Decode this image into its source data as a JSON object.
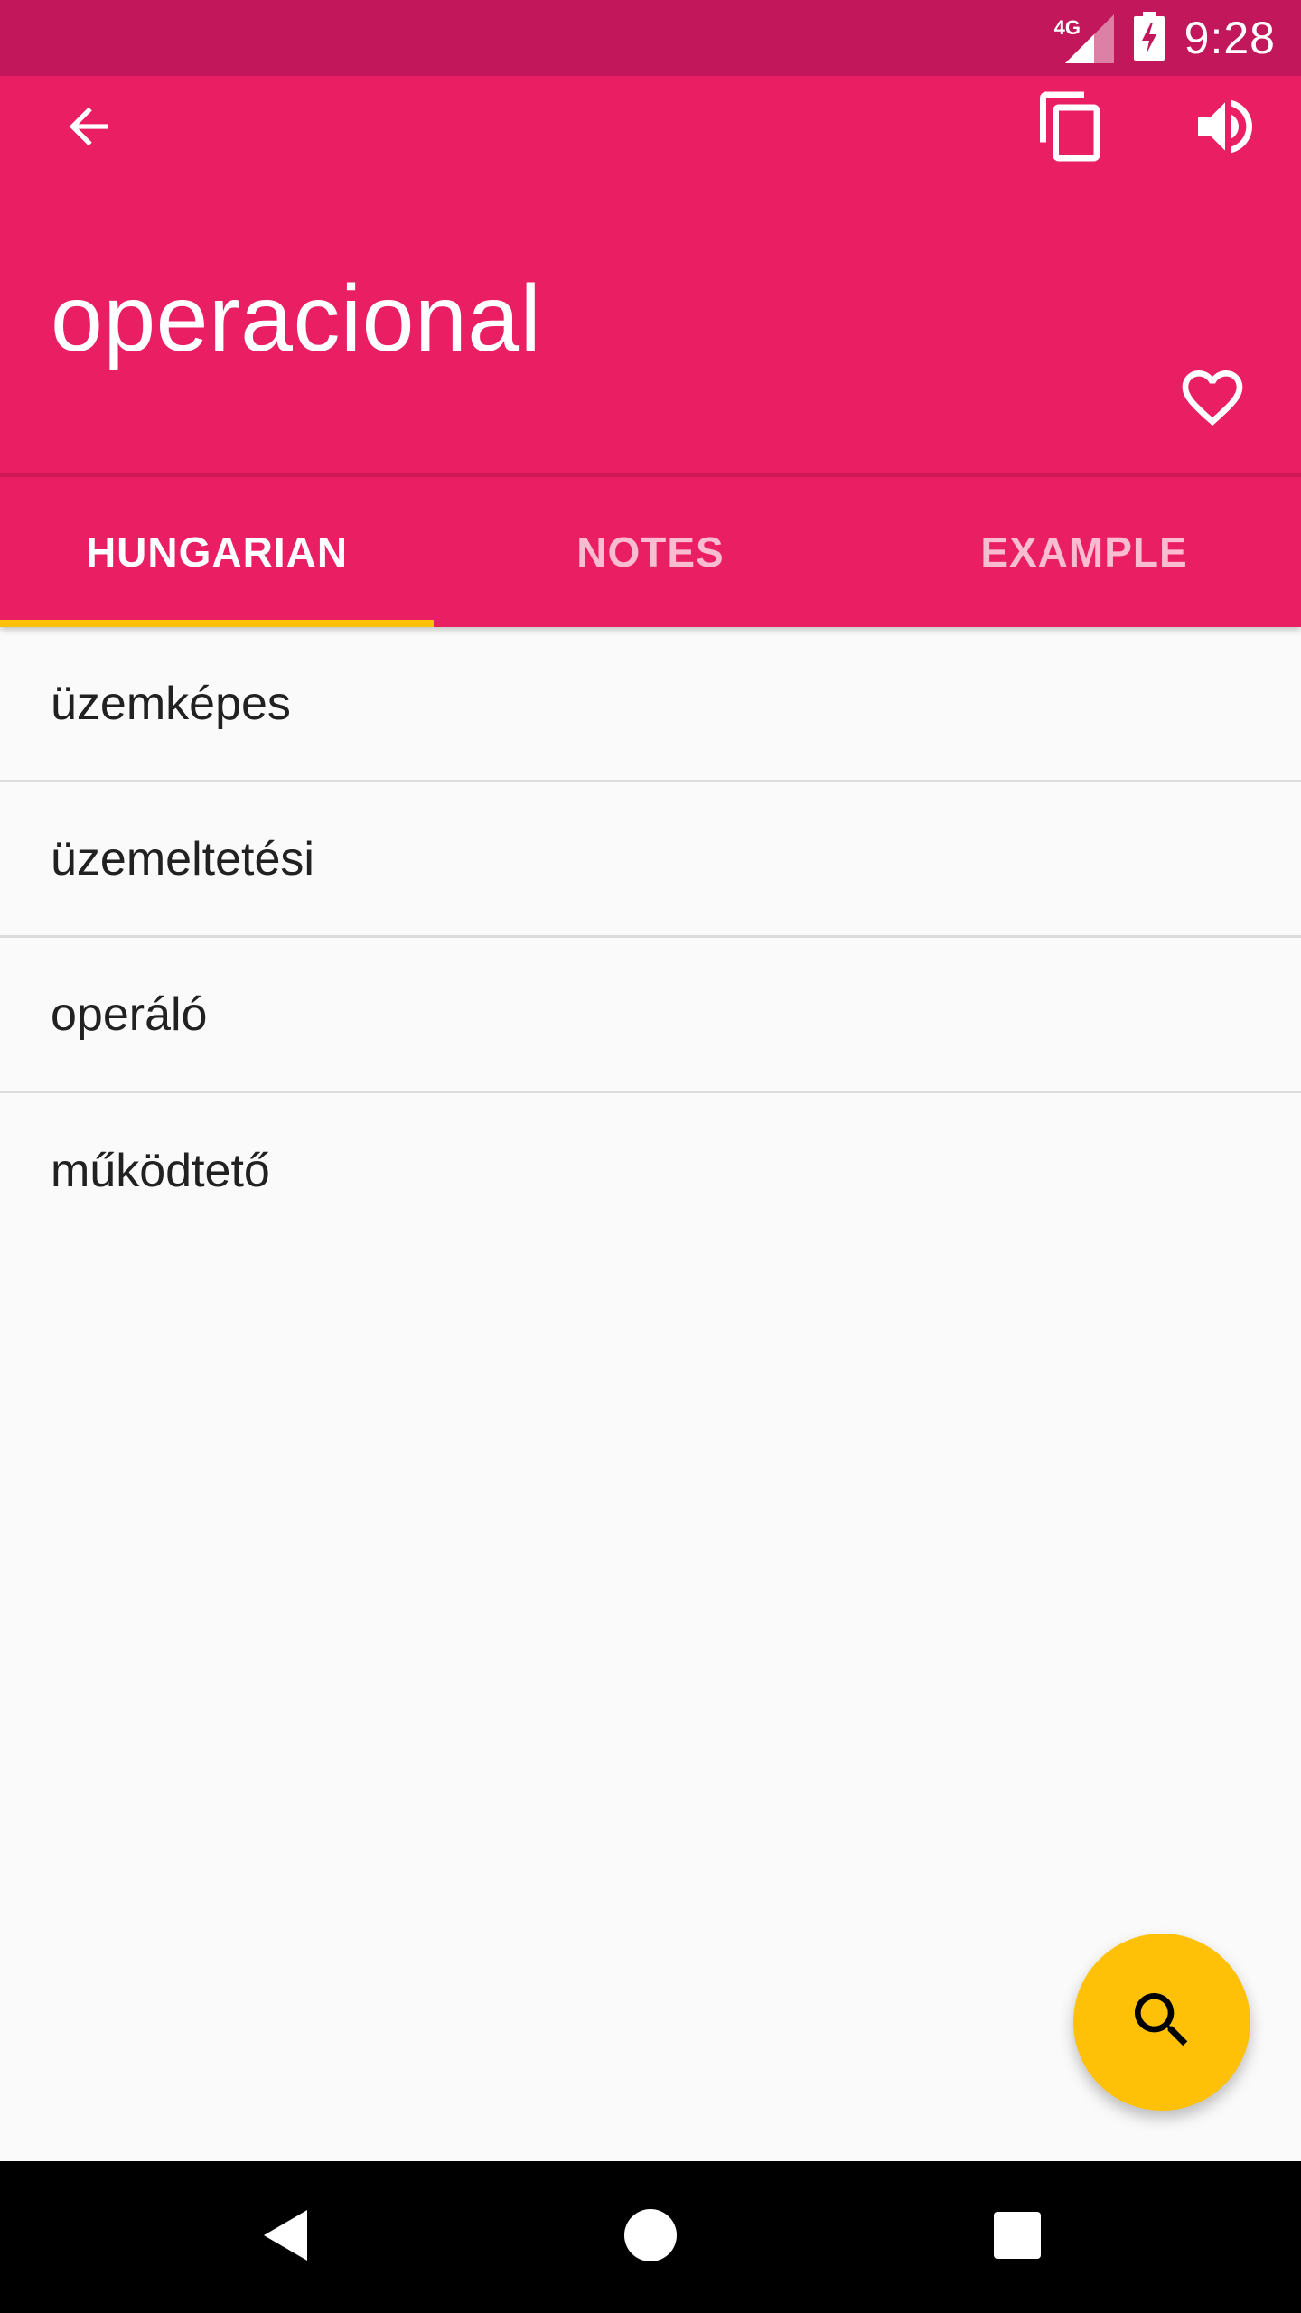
{
  "status_bar": {
    "network_label": "4G",
    "time": "9:28",
    "background_color": "#c2185b"
  },
  "app_bar": {
    "background_color": "#e91e63",
    "back_icon": "arrow-back-icon",
    "copy_icon": "copy-icon",
    "sound_icon": "volume-up-icon",
    "favorite_icon": "heart-outline-icon",
    "title": "operacional"
  },
  "tabs": [
    {
      "label": "HUNGARIAN",
      "active": true
    },
    {
      "label": "NOTES",
      "active": false
    },
    {
      "label": "EXAMPLE",
      "active": false
    }
  ],
  "tab_indicator_color": "#ffc107",
  "translations": [
    "üzemképes",
    "üzemeltetési",
    "operáló",
    "működtető"
  ],
  "fab": {
    "icon": "search-icon",
    "color": "#ffc107"
  },
  "nav_bar": {
    "back_icon": "nav-back-icon",
    "home_icon": "nav-home-icon",
    "recent_icon": "nav-recent-icon"
  }
}
